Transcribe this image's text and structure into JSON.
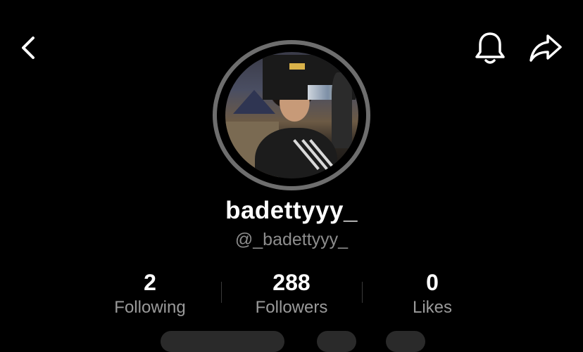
{
  "header": {
    "back_icon": "chevron-left-icon",
    "notification_icon": "bell-icon",
    "share_icon": "share-arrow-icon"
  },
  "profile": {
    "display_name": "badettyyy_",
    "username": "@_badettyyy_"
  },
  "stats": [
    {
      "value": "2",
      "label": "Following"
    },
    {
      "value": "288",
      "label": "Followers"
    },
    {
      "value": "0",
      "label": "Likes"
    }
  ]
}
